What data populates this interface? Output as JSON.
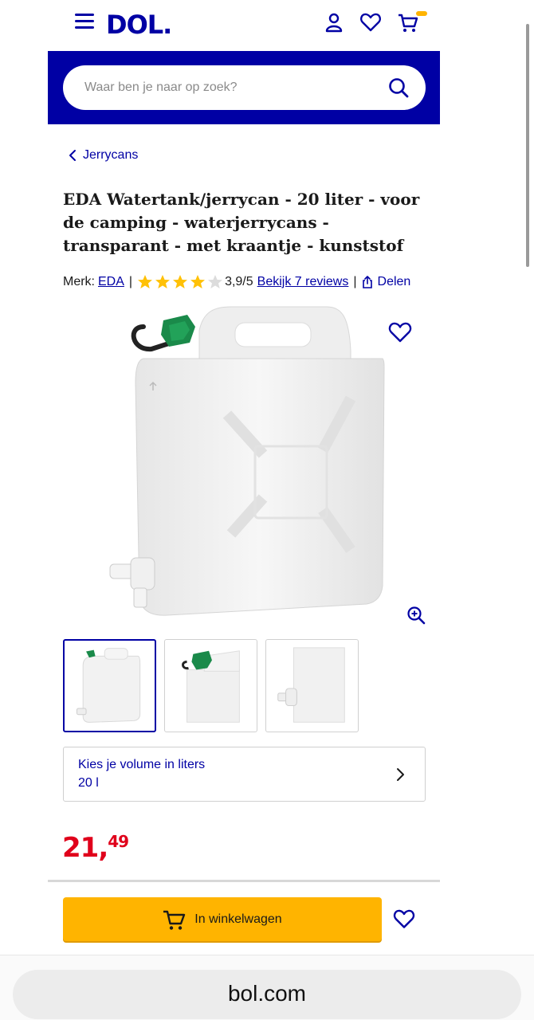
{
  "header": {
    "logo_text": "DOL.",
    "icons": [
      "menu-icon",
      "account-icon",
      "heart-icon",
      "cart-icon"
    ]
  },
  "search": {
    "placeholder": "Waar ben je naar op zoek?"
  },
  "breadcrumb": {
    "label": "Jerrycans"
  },
  "product": {
    "title": "EDA Watertank/jerrycan - 20 liter - voor de camping - waterjerrycans - transparant - met kraantje - kunststof",
    "brand_label": "Merk:",
    "brand": "EDA",
    "rating": 3.9,
    "rating_text": "3,9/5",
    "reviews_link": "Bekijk 7 reviews",
    "share_label": "Delen",
    "volume_label": "Kies je volume in liters",
    "volume_value": "20 l",
    "price_whole": "21,",
    "price_cents": "49",
    "add_to_cart": "In winkelwagen"
  },
  "colors": {
    "brand_blue": "#0000a4",
    "cart_yellow": "#ffb400",
    "price_red": "#e0001b",
    "star_yellow": "#ffc107"
  },
  "browser": {
    "url": "bol.com"
  }
}
